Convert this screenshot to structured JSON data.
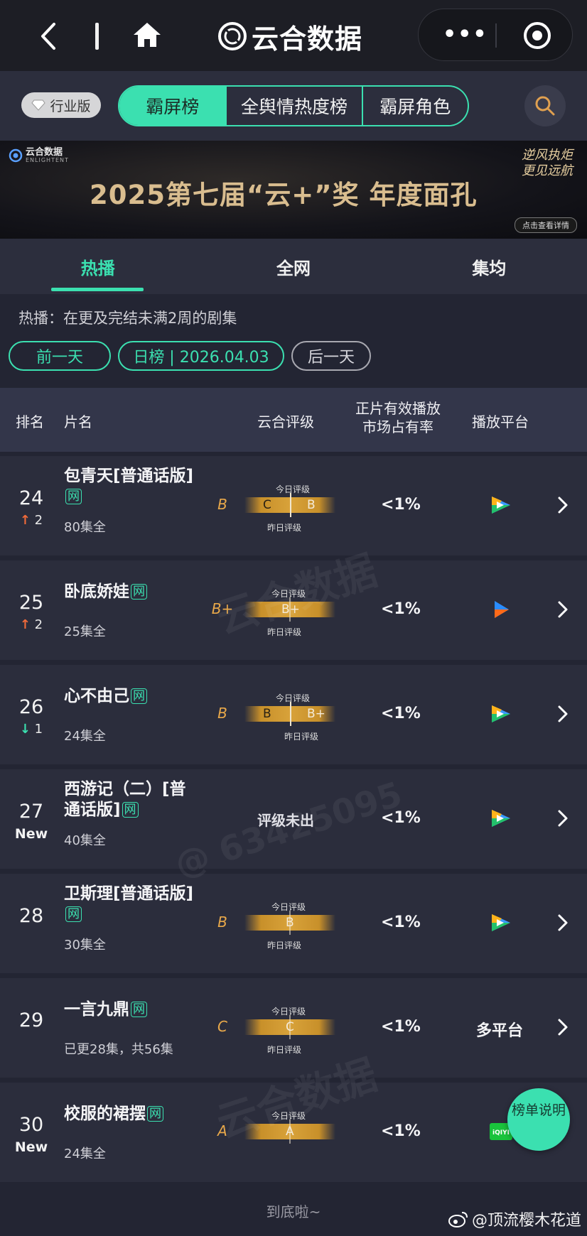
{
  "nav": {
    "title": "云合数据"
  },
  "top": {
    "badge": "行业版",
    "tabs": [
      "霸屏榜",
      "全舆情热度榜",
      "霸屏角色"
    ]
  },
  "banner": {
    "brand": "云合数据",
    "brand_en": "ENLIGHTENT",
    "headline": "2025第七届“云+”奖  年度面孔",
    "slogan": "逆风执炬 更见远航",
    "cta": "点击查看详情"
  },
  "subtabs": [
    "热播",
    "全网",
    "集均"
  ],
  "desc": "热播：在更及完结未满2周的剧集",
  "date_buttons": {
    "prev": "前一天",
    "current": "日榜 | 2026.04.03",
    "next": "后一天"
  },
  "table": {
    "headers": {
      "rank": "排名",
      "name": "片名",
      "rating": "云合评级",
      "share": "正片有效播放市场占有率",
      "platform": "播放平台"
    },
    "caption_today": "今日评级",
    "caption_yesterday": "昨日评级",
    "net_tag": "网",
    "rows": [
      {
        "rank": "24",
        "change": "2",
        "dir": "up",
        "title": "包青天[普通话版]",
        "eps": "80集全",
        "grade": "B",
        "left": "C",
        "right": "B",
        "share": "<1%",
        "platform": "tencent"
      },
      {
        "rank": "25",
        "change": "2",
        "dir": "up",
        "title": "卧底娇娃",
        "eps": "25集全",
        "grade": "B+",
        "left": "B+",
        "right": "",
        "share": "<1%",
        "platform": "youku"
      },
      {
        "rank": "26",
        "change": "1",
        "dir": "down",
        "title": "心不由己",
        "eps": "24集全",
        "grade": "B",
        "left": "B",
        "right": "B+",
        "share": "<1%",
        "platform": "tencent"
      },
      {
        "rank": "27",
        "change": "New",
        "dir": "new",
        "title": "西游记（二）[普通话版]",
        "eps": "40集全",
        "grade": "",
        "pending": "评级未出",
        "share": "<1%",
        "platform": "tencent"
      },
      {
        "rank": "28",
        "change": "",
        "dir": "none",
        "title": "卫斯理[普通话版]",
        "eps": "30集全",
        "grade": "B",
        "left": "B",
        "right": "",
        "share": "<1%",
        "platform": "tencent"
      },
      {
        "rank": "29",
        "change": "",
        "dir": "none",
        "title": "一言九鼎",
        "eps": "已更28集，共56集",
        "grade": "C",
        "left": "C",
        "right": "",
        "share": "<1%",
        "platform_text": "多平台"
      },
      {
        "rank": "30",
        "change": "New",
        "dir": "new",
        "title": "校服的裙摆",
        "eps": "24集全",
        "grade": "A",
        "left": "A",
        "right": "",
        "share": "<1%",
        "platform": "iqiyi"
      }
    ]
  },
  "footer": "到底啦~",
  "fab": "榜单说明",
  "watermark": {
    "brand": "云合数据",
    "brand_en": "ENLIGHTENT",
    "id": "@ 63425095"
  },
  "weibo": "@顶流樱木花道",
  "colors": {
    "accent": "#3be0b0",
    "up": "#f06a3a",
    "grade": "#e8a84a"
  }
}
